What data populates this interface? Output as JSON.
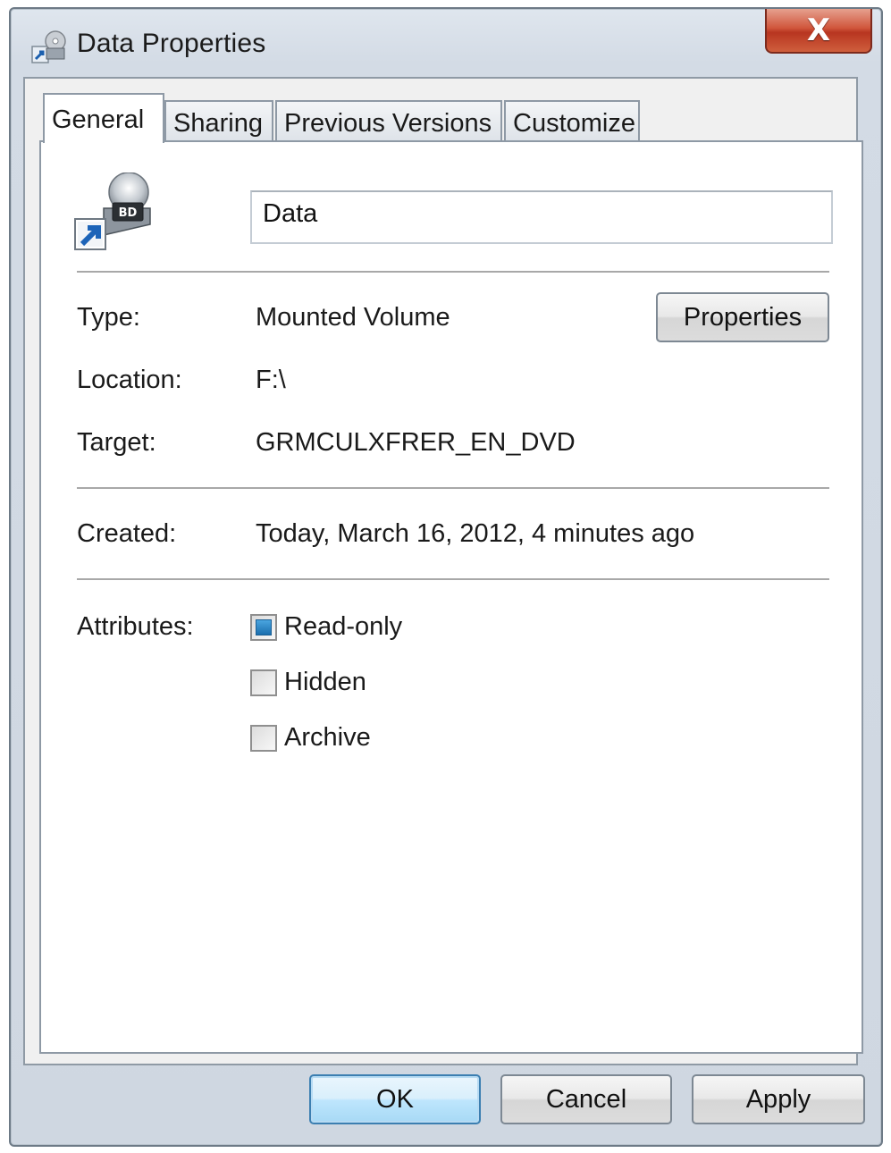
{
  "window": {
    "title": "Data Properties",
    "close_label": "X"
  },
  "tabs": [
    {
      "label": "General",
      "active": true
    },
    {
      "label": "Sharing",
      "active": false
    },
    {
      "label": "Previous Versions",
      "active": false
    },
    {
      "label": "Customize",
      "active": false
    }
  ],
  "general": {
    "icon": "bd-drive-shortcut-icon",
    "name_value": "Data",
    "type_label": "Type:",
    "type_value": "Mounted Volume",
    "properties_button": "Properties",
    "location_label": "Location:",
    "location_value": "F:\\",
    "target_label": "Target:",
    "target_value": "GRMCULXFRER_EN_DVD",
    "created_label": "Created:",
    "created_value": "Today, March 16, 2012, 4 minutes ago",
    "attributes_label": "Attributes:",
    "attributes": [
      {
        "label": "Read-only",
        "state": "indeterminate"
      },
      {
        "label": "Hidden",
        "state": "unchecked"
      },
      {
        "label": "Archive",
        "state": "unchecked"
      }
    ]
  },
  "footer": {
    "ok": "OK",
    "cancel": "Cancel",
    "apply": "Apply"
  },
  "colors": {
    "accent": "#1a6fae",
    "close": "#c8452e",
    "frame": "#d3dbe5"
  }
}
